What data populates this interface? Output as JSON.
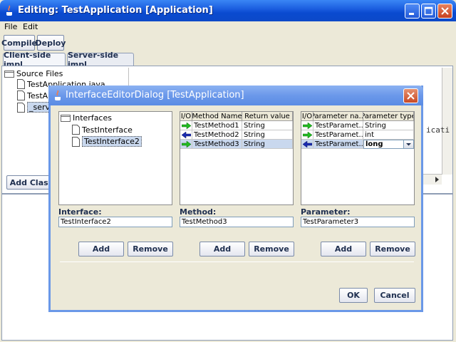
{
  "main_window": {
    "title": "Editing: TestApplication [Application]",
    "menu": [
      "File",
      "Edit"
    ],
    "toolbar": {
      "compile_label": "Compile",
      "deploy_label": "Deploy"
    },
    "tabs": [
      {
        "label": "Client-side impl.",
        "active": true
      },
      {
        "label": "Server-side impl.",
        "active": false
      }
    ],
    "tree": {
      "root": "Source Files",
      "items": [
        "TestApplication.java",
        "TestAp",
        "_serve"
      ]
    },
    "right_snippet": "icati",
    "add_class_label": "Add Class"
  },
  "dialog": {
    "title": "InterfaceEditorDialog [TestApplication]",
    "interfaces": {
      "root": "Interfaces",
      "items": [
        {
          "label": "TestInterface",
          "selected": false
        },
        {
          "label": "TestInterface2",
          "selected": true
        }
      ],
      "field_label": "Interface:",
      "field_value": "TestInterface2"
    },
    "methods": {
      "headers": [
        "I/O",
        "Method Name",
        "Return value"
      ],
      "rows": [
        {
          "direction": "in",
          "name": "TestMethod1",
          "return_type": "String",
          "selected": false
        },
        {
          "direction": "out",
          "name": "TestMethod2",
          "return_type": "String",
          "selected": false
        },
        {
          "direction": "in",
          "name": "TestMethod3",
          "return_type": "String",
          "selected": true
        }
      ],
      "field_label": "Method:",
      "field_value": "TestMethod3"
    },
    "parameters": {
      "headers": [
        "I/O",
        "Parameter na...",
        "Parameter type"
      ],
      "rows": [
        {
          "direction": "in",
          "name": "TestParamet...",
          "type": "String",
          "selected": false
        },
        {
          "direction": "in",
          "name": "TestParamet...",
          "type": "int",
          "selected": false
        },
        {
          "direction": "out",
          "name": "TestParamet...",
          "type": "long",
          "selected": true
        }
      ],
      "field_label": "Parameter:",
      "field_value": "TestParameter3"
    },
    "add_label": "Add",
    "remove_label": "Remove",
    "ok_label": "OK",
    "cancel_label": "Cancel"
  },
  "colors": {
    "in_arrow": "#22bb22",
    "out_arrow": "#1a2bb0",
    "selection": "#c9d8ee",
    "titlebar_active": "#0a4ad0",
    "dialog_titlebar": "#6b98ea"
  }
}
